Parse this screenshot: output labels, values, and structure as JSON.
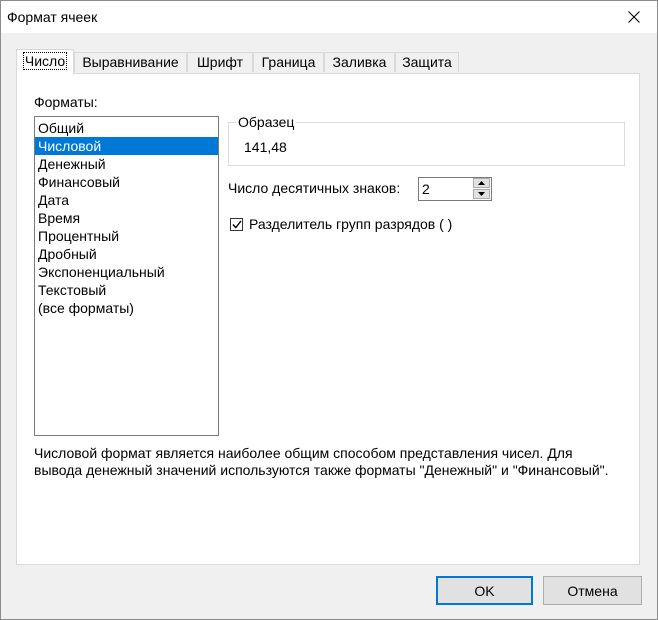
{
  "window": {
    "title": "Формат ячеек"
  },
  "tabs": [
    {
      "label": "Число",
      "active": true
    },
    {
      "label": "Выравнивание",
      "active": false
    },
    {
      "label": "Шрифт",
      "active": false
    },
    {
      "label": "Граница",
      "active": false
    },
    {
      "label": "Заливка",
      "active": false
    },
    {
      "label": "Защита",
      "active": false
    }
  ],
  "formats": {
    "label": "Форматы:",
    "selected_index": 1,
    "items": [
      "Общий",
      "Числовой",
      "Денежный",
      "Финансовый",
      "Дата",
      "Время",
      "Процентный",
      "Дробный",
      "Экспоненциальный",
      "Текстовый",
      "(все форматы)"
    ]
  },
  "sample": {
    "legend": "Образец",
    "value": "141,48"
  },
  "decimals": {
    "label": "Число десятичных знаков:",
    "value": "2"
  },
  "separator": {
    "label": "Разделитель групп разрядов ( )",
    "checked": true
  },
  "description": "Числовой формат является наиболее общим способом представления чисел. Для вывода денежный значений используются также форматы \"Денежный\" и \"Финансовый\".",
  "buttons": {
    "ok": "OK",
    "cancel": "Отмена"
  },
  "colors": {
    "selection": "#0078d7",
    "dialog_bg": "#f0f0f0",
    "default_button_border": "#0078d7"
  }
}
